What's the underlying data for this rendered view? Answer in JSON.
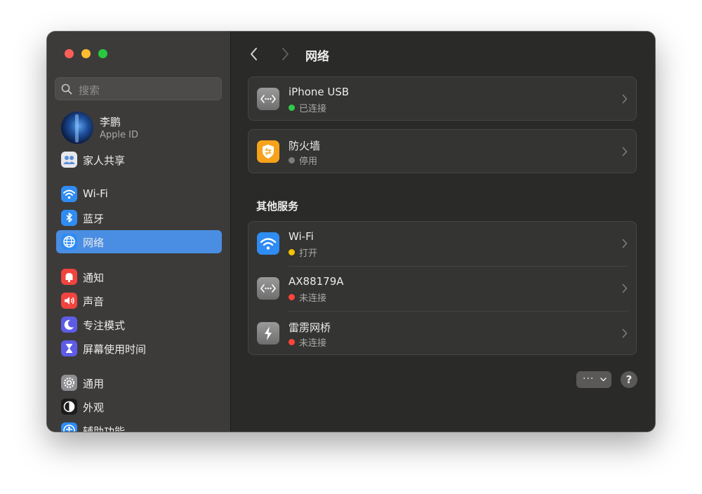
{
  "window": {
    "title": "网络"
  },
  "sidebar": {
    "search": {
      "placeholder": "搜索"
    },
    "profile": {
      "name": "李鹏",
      "subtitle": "Apple ID"
    },
    "items": [
      {
        "label": "家人共享",
        "icon": "family-sharing-icon"
      },
      {
        "label": "Wi-Fi",
        "icon": "wifi-icon"
      },
      {
        "label": "蓝牙",
        "icon": "bluetooth-icon"
      },
      {
        "label": "网络",
        "icon": "globe-icon",
        "selected": true
      },
      {
        "label": "通知",
        "icon": "bell-icon"
      },
      {
        "label": "声音",
        "icon": "speaker-icon"
      },
      {
        "label": "专注模式",
        "icon": "moon-icon"
      },
      {
        "label": "屏幕使用时间",
        "icon": "hourglass-icon"
      },
      {
        "label": "通用",
        "icon": "gear-icon"
      },
      {
        "label": "外观",
        "icon": "appearance-icon"
      },
      {
        "label": "辅助功能",
        "icon": "accessibility-icon"
      }
    ]
  },
  "main": {
    "services": [
      {
        "title": "iPhone USB",
        "status": "已连接",
        "status_color": "#30c94c",
        "icon": "ethernet-icon"
      },
      {
        "title": "防火墙",
        "status": "停用",
        "status_color": "#7d7c7a",
        "icon": "firewall-icon"
      }
    ],
    "other_header": "其他服务",
    "other_services": [
      {
        "title": "Wi-Fi",
        "status": "打开",
        "status_color": "#f5c400",
        "icon": "wifi-icon"
      },
      {
        "title": "AX88179A",
        "status": "未连接",
        "status_color": "#ff453a",
        "icon": "ethernet-icon"
      },
      {
        "title": "雷雳网桥",
        "status": "未连接",
        "status_color": "#ff453a",
        "icon": "thunderbolt-icon"
      }
    ],
    "more_label": "···",
    "help_label": "?"
  },
  "colors": {
    "accent": "#4a8ee3",
    "window_bg": "#2a2a28",
    "sidebar_bg": "#3c3b3a"
  }
}
